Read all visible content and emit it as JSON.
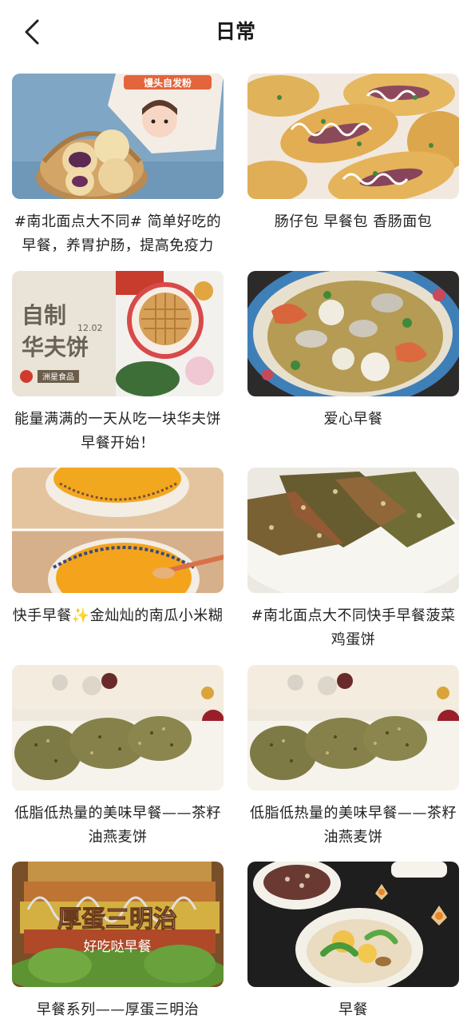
{
  "header": {
    "title": "日常",
    "back_icon": "chevron-left-icon"
  },
  "cards": [
    {
      "caption": "#南北面点大不同# 简单好吃的早餐，养胃护肠，提高免疫力",
      "overlay_lines": [
        "馒头自发粉"
      ]
    },
    {
      "caption": "肠仔包 早餐包 香肠面包",
      "overlay_lines": []
    },
    {
      "caption": "能量满满的一天从吃一块华夫饼早餐开始！",
      "overlay_lines": [
        "自制",
        "华夫饼",
        "12.02",
        "洲星食品"
      ]
    },
    {
      "caption": "爱心早餐",
      "overlay_lines": []
    },
    {
      "caption": "快手早餐✨金灿灿的南瓜小米糊",
      "overlay_lines": []
    },
    {
      "caption": "#南北面点大不同快手早餐菠菜鸡蛋饼",
      "overlay_lines": []
    },
    {
      "caption": "低脂低热量的美味早餐——茶籽油燕麦饼",
      "overlay_lines": []
    },
    {
      "caption": "低脂低热量的美味早餐——茶籽油燕麦饼",
      "overlay_lines": []
    },
    {
      "caption": "早餐系列——厚蛋三明治",
      "overlay_lines": [
        "厚蛋三明治",
        "好吃哒早餐"
      ]
    },
    {
      "caption": "早餐",
      "overlay_lines": []
    }
  ]
}
